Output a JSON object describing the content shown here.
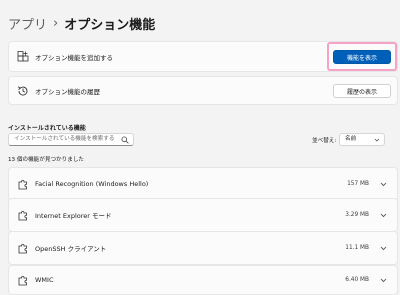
{
  "breadcrumb": {
    "parent": "アプリ",
    "separator": "›",
    "current": "オプション機能"
  },
  "add_feature": {
    "label": "オプション機能を追加する",
    "button": "機能を表示"
  },
  "history": {
    "label": "オプション機能の履歴",
    "button": "履歴の表示"
  },
  "installed": {
    "title": "インストールされている機能",
    "search_placeholder": "インストールされている機能を検索する",
    "sort_label": "並べ替え:",
    "sort_value": "名前",
    "count_text": "13 個の機能が見つかりました"
  },
  "features": [
    {
      "name": "Facial Recognition (Windows Hello)",
      "size": "157 MB"
    },
    {
      "name": "Internet Explorer モード",
      "size": "3.29 MB"
    },
    {
      "name": "OpenSSH クライアント",
      "size": "11.1 MB"
    },
    {
      "name": "WMIC",
      "size": "6.40 MB"
    }
  ],
  "colors": {
    "accent": "#005fb8",
    "highlight": "#f4a3c6",
    "background": "#f3f3f3"
  },
  "icons": {
    "add_feature": "add-feature-icon",
    "history": "history-icon",
    "feature": "puzzle-icon",
    "expand": "chevron-down-icon",
    "search": "search-icon"
  }
}
